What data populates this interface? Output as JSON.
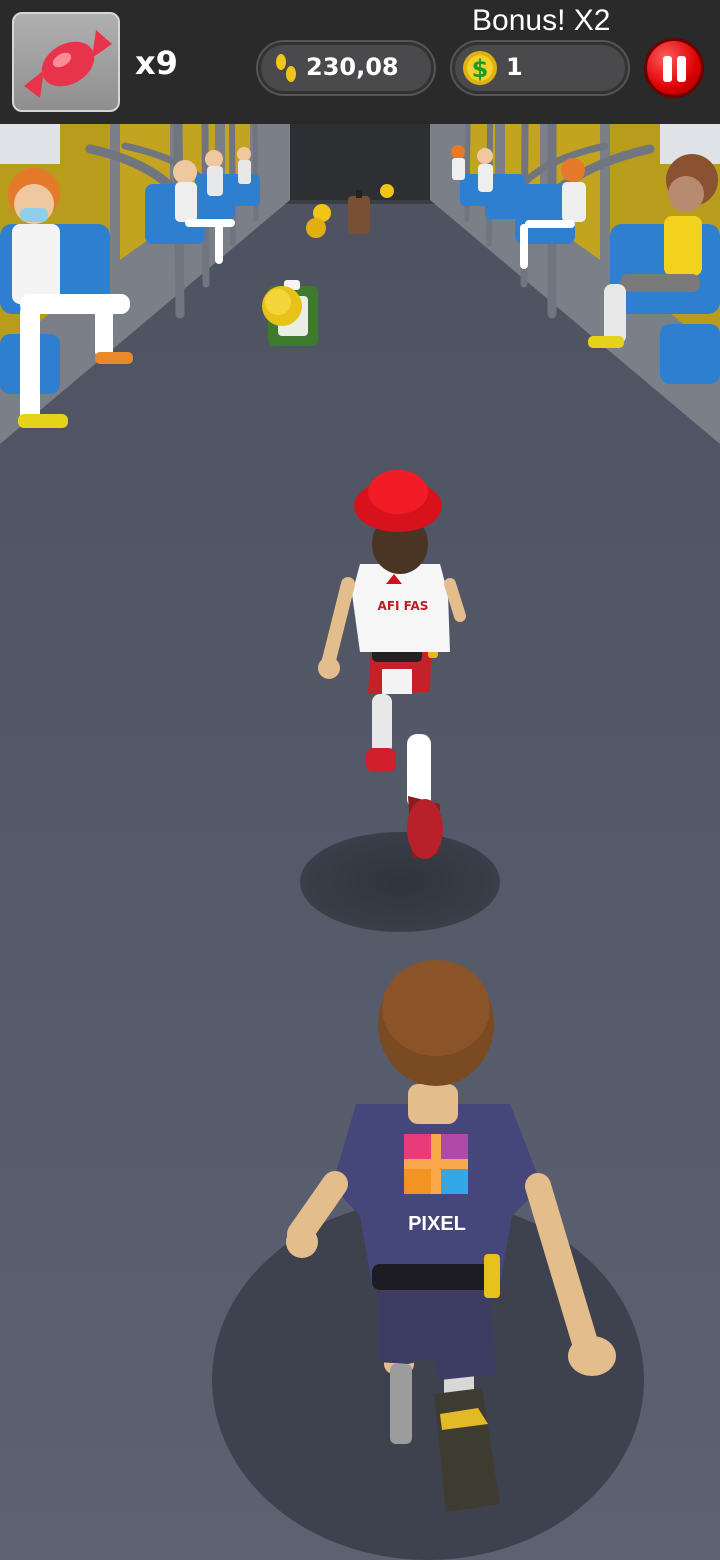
{
  "hud": {
    "candy_icon": "candy-icon",
    "candy_count": "x9",
    "steps_icon": "footprints-icon",
    "steps_value": "230,08",
    "coins_icon": "dollar-coin-icon",
    "coins_value": "1",
    "bonus_text": "Bonus! X2",
    "pause_icon": "pause-icon"
  },
  "characters": {
    "rival_shirt_text": "AFI FAS",
    "player_shirt_text": "PIXEL"
  },
  "colors": {
    "hud_bg": "#2a2a2b",
    "floor": "#5a606f",
    "pause_red": "#e00000",
    "coin_gold": "#f0c419",
    "candy_red": "#e8344a"
  }
}
